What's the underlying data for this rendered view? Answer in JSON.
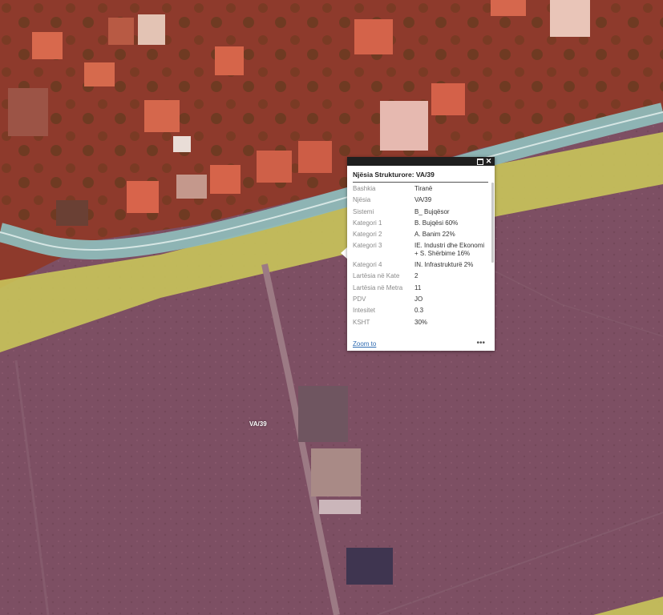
{
  "map": {
    "parcel_label": "VA/39",
    "colors": {
      "residential_zone": "#9a3a2e",
      "agricultural_zone": "#7d4f63",
      "buffer_zone": "#c9c45a",
      "road": "#8fb9b8"
    }
  },
  "popup": {
    "title": "Njësia Strukturore: VA/39",
    "attributes": [
      {
        "key": "Bashkia",
        "value": "Tiranë"
      },
      {
        "key": "Njësia",
        "value": "VA/39"
      },
      {
        "key": "Sistemi",
        "value": "B_ Bujqësor"
      },
      {
        "key": "Kategori 1",
        "value": "B. Bujqësi 60%"
      },
      {
        "key": "Kategori 2",
        "value": "A. Banim 22%"
      },
      {
        "key": "Kategori 3",
        "value": "IE. Industri dhe Ekonomi + S. Shërbime 16%"
      },
      {
        "key": "Kategori 4",
        "value": "IN. Infrastrukturë 2%"
      },
      {
        "key": "Lartësia në Kate",
        "value": "2"
      },
      {
        "key": "Lartësia në Metra",
        "value": "11"
      },
      {
        "key": "PDV",
        "value": "JO"
      },
      {
        "key": "Intesitet",
        "value": "0.3"
      },
      {
        "key": "KSHT",
        "value": "30%"
      }
    ],
    "zoom_label": "Zoom to",
    "more_label": "•••",
    "close_label": "✕"
  }
}
